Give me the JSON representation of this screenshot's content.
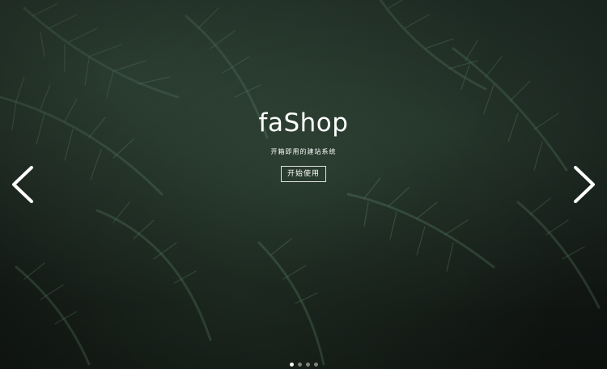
{
  "hero": {
    "logo": "faShop",
    "tagline": "开箱即用的建站系统",
    "cta_label": "开始使用"
  },
  "carousel": {
    "prev_icon": "chevron-left-icon",
    "next_icon": "chevron-right-icon",
    "slide_count": 4,
    "active_index": 0
  },
  "colors": {
    "text": "#ffffff",
    "background": "#1a231f",
    "foliage": "#3f5c46"
  }
}
